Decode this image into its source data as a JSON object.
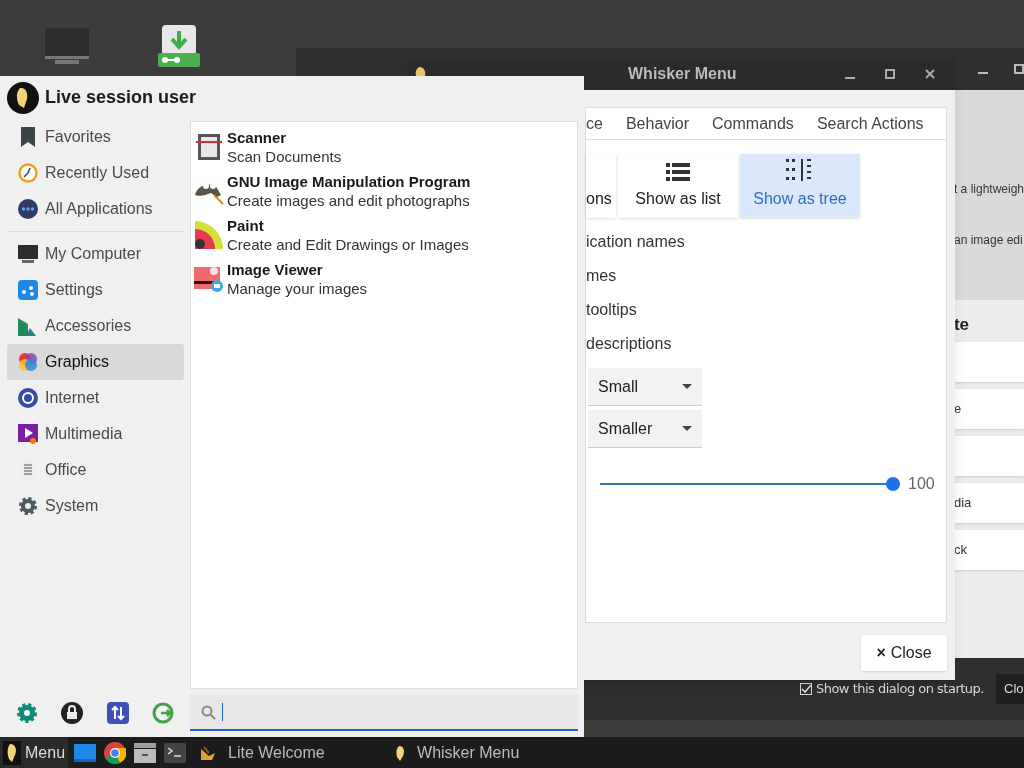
{
  "background_window": {
    "lines": [
      "t a lightweigh",
      "an image edi"
    ],
    "heading": "te",
    "buttons": [
      {
        "kind": "blank"
      },
      {
        "kind": "text",
        "label": "e"
      },
      {
        "kind": "blank"
      },
      {
        "kind": "text",
        "label": "dia"
      },
      {
        "kind": "text",
        "label": "ck"
      }
    ],
    "startup_checkbox": {
      "label": "Show this dialog on startup.",
      "checked": true
    },
    "close_button": "Clo"
  },
  "settings_dialog": {
    "title": "Whisker Menu",
    "tabs": [
      {
        "label": "ce",
        "selected": false
      },
      {
        "label": "Behavior",
        "selected": false
      },
      {
        "label": "Commands",
        "selected": false
      },
      {
        "label": "Search Actions",
        "selected": false
      }
    ],
    "view_buttons": [
      {
        "label": "ons",
        "kind": "partial",
        "selected": false
      },
      {
        "label": "Show as list",
        "kind": "list",
        "selected": false
      },
      {
        "label": "Show as tree",
        "kind": "tree",
        "selected": true
      }
    ],
    "options": [
      "ication names",
      "mes",
      "tooltips",
      "descriptions"
    ],
    "dropdowns": [
      "Small",
      "Smaller"
    ],
    "slider": {
      "level": 1,
      "reading": "100"
    },
    "close_button": {
      "icon": "×",
      "label": "Close"
    }
  },
  "menu": {
    "user": "Live session user",
    "category_groups": [
      [
        {
          "label": "Favorites",
          "selected": false
        },
        {
          "label": "Recently Used",
          "selected": false
        },
        {
          "label": "All Applications",
          "selected": false
        }
      ],
      [
        {
          "label": "My Computer",
          "selected": false
        },
        {
          "label": "Settings",
          "selected": false
        },
        {
          "label": "Accessories",
          "selected": false
        },
        {
          "label": "Graphics",
          "selected": true
        },
        {
          "label": "Internet",
          "selected": false
        },
        {
          "label": "Multimedia",
          "selected": false
        },
        {
          "label": "Office",
          "selected": false
        },
        {
          "label": "System",
          "selected": false
        }
      ]
    ],
    "apps": [
      {
        "name": "Scanner",
        "description": "Scan Documents"
      },
      {
        "name": "GNU Image Manipulation Program",
        "description": "Create images and edit photographs"
      },
      {
        "name": "Paint",
        "description": "Create and Edit Drawings or Images"
      },
      {
        "name": "Image Viewer",
        "description": "Manage your images"
      }
    ]
  },
  "taskbar": {
    "menu_button": "Menu",
    "tasks": [
      {
        "label": "Lite Welcome"
      },
      {
        "label": "Whisker Menu"
      }
    ]
  }
}
